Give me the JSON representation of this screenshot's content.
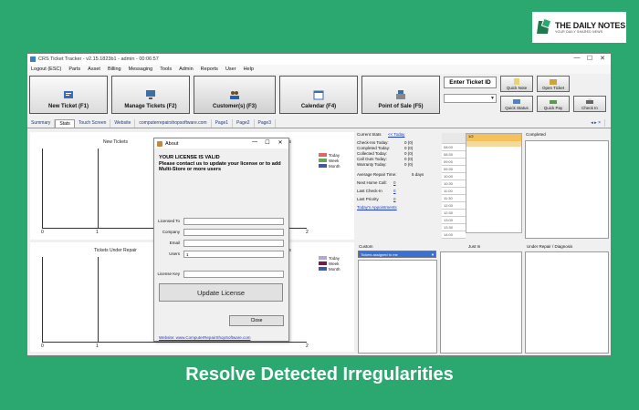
{
  "logo": {
    "title": "THE DAILY NOTES",
    "subtitle": "YOUR DAILY SHARED NEWS"
  },
  "app": {
    "title": "CRS Ticket Tracker - v2.15.1823b1 - admin - 00:06:57",
    "win_controls": {
      "minimize": "—",
      "maximize": "☐",
      "close": "✕"
    },
    "menu": [
      "Logout (ESC)",
      "Parts",
      "Asset",
      "Billing",
      "Messaging",
      "Tools",
      "Admin",
      "Reports",
      "User",
      "Help"
    ],
    "toolbar": {
      "new_ticket": "New Ticket (F1)",
      "manage_tickets": "Manage Tickets (F2)",
      "customers": "Customer(s) (F3)",
      "calendar": "Calendar (F4)",
      "pos": "Point of Sale (F5)",
      "enter_ticket_label": "Enter Ticket ID",
      "quick_note": "Quick Note",
      "open_ticket": "Open Ticket",
      "quick_status": "Quick Status",
      "quick_pay": "Quick Pay",
      "checkin": "Check In"
    },
    "tabs": [
      "Summary",
      "Stats",
      "Touch Screen",
      "Website",
      "computerrepairshopsoftware.com",
      "Page1",
      "Page2",
      "Page3"
    ],
    "active_tab": "Stats",
    "tab_scroll": "◂ ▸ ×",
    "charts": {
      "top_title": "New Tickets",
      "bottom_title": "Tickets Under Repair",
      "right_axis_text": "ts",
      "x_ticks": [
        "0",
        "1",
        "2"
      ],
      "legend": [
        {
          "label": "Today",
          "color": "#e06666"
        },
        {
          "label": "Week",
          "color": "#6aa84f"
        },
        {
          "label": "Month",
          "color": "#3c5aa6"
        }
      ],
      "legend2": [
        {
          "label": "Today",
          "color": "#b4a7d6"
        },
        {
          "label": "Week",
          "color": "#741b47"
        },
        {
          "label": "Month",
          "color": "#3c5aa6"
        }
      ]
    },
    "stats": {
      "heading": "Current Stats",
      "today_link": "<< Today",
      "rows": [
        {
          "label": "Check-Ins Today:",
          "value": "0 (0)"
        },
        {
          "label": "Completed Today:",
          "value": "0 (0)"
        },
        {
          "label": "Collected Today:",
          "value": "0 (0)"
        },
        {
          "label": "Call Outs Today:",
          "value": "0 (0)"
        },
        {
          "label": "Warranty Today:",
          "value": "0 (0)"
        }
      ],
      "avg_repair_label": "Average Repair Time:",
      "avg_repair_value": "5 days",
      "links": [
        {
          "label": "Next Home Call:",
          "value": "0"
        },
        {
          "label": "Last Check-In",
          "value": "0"
        },
        {
          "label": "Last Priority",
          "value": "0"
        }
      ],
      "appointments_link": "Today's Appointments"
    },
    "calendar": {
      "header": "1/2",
      "times": [
        "08:00",
        "08:30",
        "09:00",
        "09:30",
        "10:00",
        "10:30",
        "11:00",
        "11:30",
        "12:00",
        "12:30",
        "13:00",
        "13:30",
        "14:00"
      ]
    },
    "panels": {
      "completed": "Completed",
      "custom": "Custom",
      "custom_selected": "Tickets assigned to me",
      "just_in": "Just In",
      "under_repair": "Under Repair / Diagnosis"
    }
  },
  "dialog": {
    "title": "About",
    "message": "YOUR LICENSE IS VALID\nPlease contact us to update your license or to add Multi-Store or more users",
    "fields": {
      "licensed_to_label": "Licensed To",
      "company_label": "Company",
      "email_label": "Email",
      "users_label": "Users",
      "users_value": "1",
      "license_key_label": "License Key"
    },
    "update_button": "Update License",
    "close_button": "Close",
    "website_link": "Website: www.ComputerRepairShopSoftware.com"
  },
  "caption": "Resolve Detected Irregularities"
}
